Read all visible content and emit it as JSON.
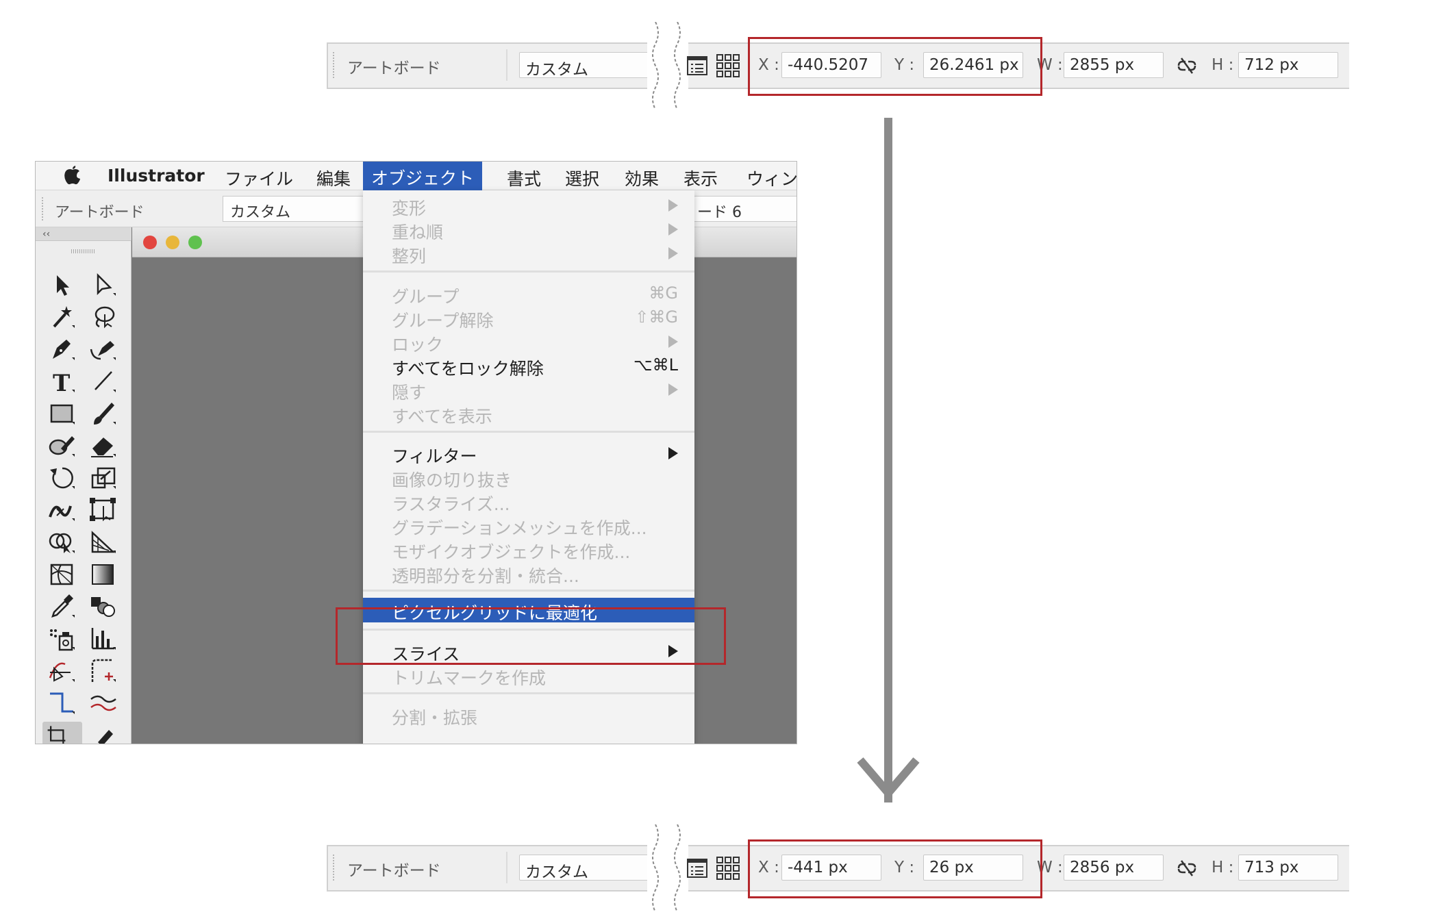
{
  "top_bar": {
    "artboard_label": "アートボード",
    "preset_value": "カスタム",
    "x_label": "X :",
    "x_value": "-440.5207",
    "y_label": "Y :",
    "y_value": "26.2461 px",
    "w_label": "W :",
    "w_value": "2855 px",
    "h_label": "H :",
    "h_value": "712 px"
  },
  "bottom_bar": {
    "artboard_label": "アートボード",
    "preset_value": "カスタム",
    "x_label": "X :",
    "x_value": "-441 px",
    "y_label": "Y :",
    "y_value": "26 px",
    "w_label": "W :",
    "w_value": "2856 px",
    "h_label": "H :",
    "h_value": "713 px"
  },
  "menubar": {
    "app_name": "Illustrator",
    "items": [
      "ファイル",
      "編集",
      "オブジェクト",
      "書式",
      "選択",
      "効果",
      "表示",
      "ウィン"
    ]
  },
  "screenshot_control": {
    "artboard_label": "アートボード",
    "preset_value": "カスタム",
    "artboard_name": "ード 6"
  },
  "toolpanel": {
    "collapse_label": "‹‹"
  },
  "object_menu": {
    "items": [
      {
        "label": "変形",
        "shortcut": ""
      },
      {
        "label": "重ね順",
        "shortcut": ""
      },
      {
        "label": "整列",
        "shortcut": ""
      },
      {
        "label": "グループ",
        "shortcut": "⌘G"
      },
      {
        "label": "グループ解除",
        "shortcut": "⇧⌘G"
      },
      {
        "label": "ロック",
        "shortcut": ""
      },
      {
        "label": "すべてをロック解除",
        "shortcut": "⌥⌘L"
      },
      {
        "label": "隠す",
        "shortcut": ""
      },
      {
        "label": "すべてを表示",
        "shortcut": ""
      },
      {
        "label": "フィルター",
        "shortcut": ""
      },
      {
        "label": "画像の切り抜き",
        "shortcut": ""
      },
      {
        "label": "ラスタライズ...",
        "shortcut": ""
      },
      {
        "label": "グラデーションメッシュを作成...",
        "shortcut": ""
      },
      {
        "label": "モザイクオブジェクトを作成...",
        "shortcut": ""
      },
      {
        "label": "透明部分を分割・統合...",
        "shortcut": ""
      },
      {
        "label": "ピクセルグリッドに最適化",
        "shortcut": ""
      },
      {
        "label": "スライス",
        "shortcut": ""
      },
      {
        "label": "トリムマークを作成",
        "shortcut": ""
      },
      {
        "label": "分割・拡張",
        "shortcut": ""
      }
    ]
  },
  "colors": {
    "highlight_red": "#b4272b",
    "menu_selection_blue": "#2c5db8",
    "arrow_gray": "#8b8b8b"
  }
}
